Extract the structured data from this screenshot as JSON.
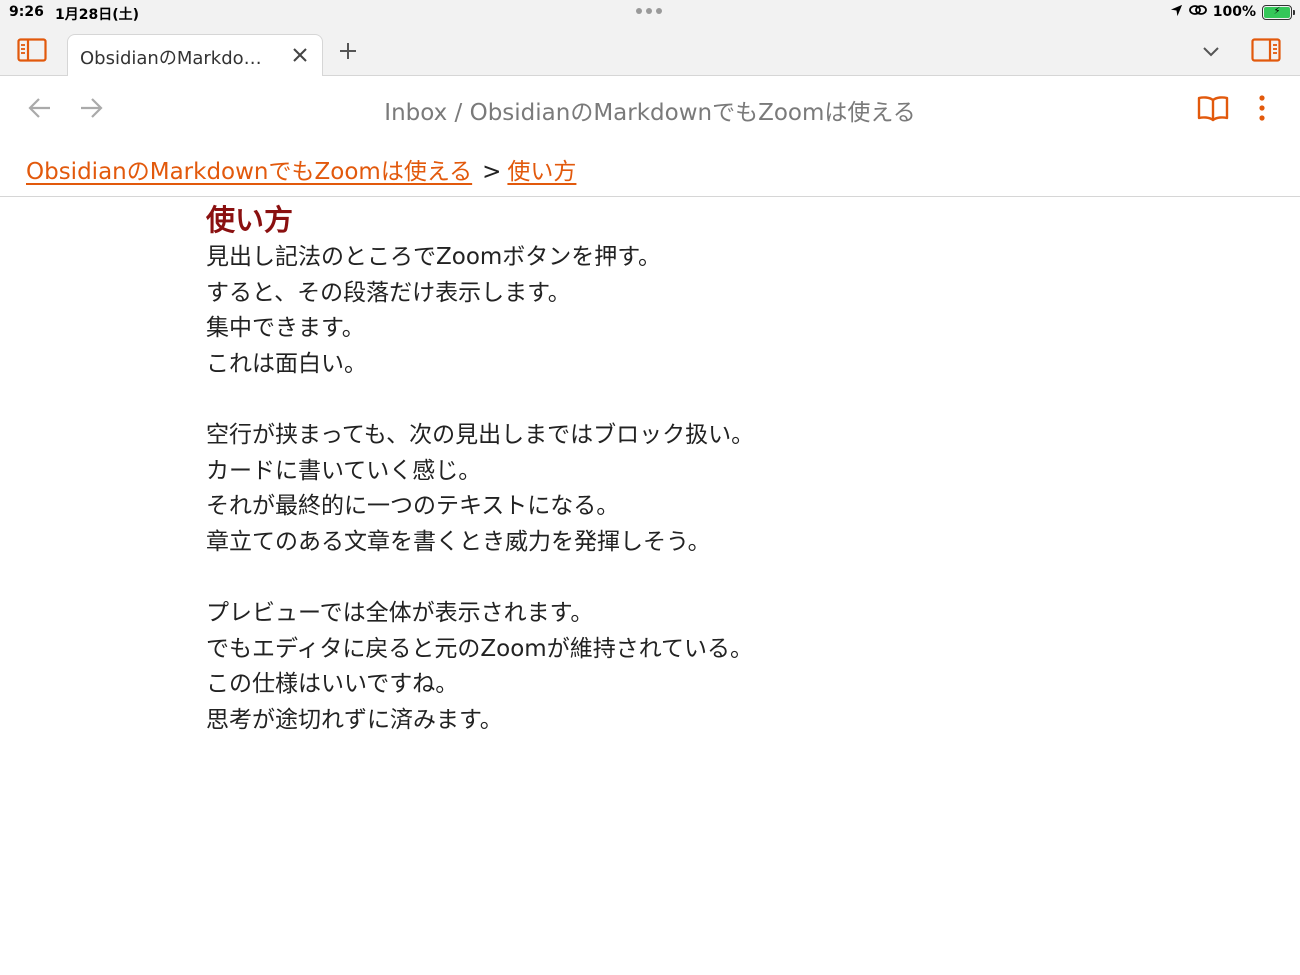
{
  "status_bar": {
    "time": "9:26",
    "date": "1月28日(土)",
    "battery": "100%",
    "icons": [
      "location-icon",
      "link-icon",
      "battery-icon"
    ]
  },
  "tab_bar": {
    "tabs": [
      {
        "label": "ObsidianのMarkdo…"
      }
    ],
    "icons": [
      "left-sidebar-icon",
      "close-icon",
      "plus-icon",
      "chevron-down-icon",
      "right-sidebar-icon"
    ]
  },
  "header": {
    "title": "Inbox / ObsidianのMarkdownでもZoomは使える",
    "icons": [
      "arrow-left-icon",
      "arrow-right-icon",
      "book-icon",
      "more-vertical-icon"
    ]
  },
  "breadcrumb": {
    "items": [
      {
        "label": "ObsidianのMarkdownでもZoomは使える"
      },
      {
        "label": "使い方"
      }
    ],
    "separator": ">"
  },
  "document": {
    "heading": "使い方",
    "lines": [
      "見出し記法のところでZoomボタンを押す。",
      "すると、その段落だけ表示します。",
      "集中できます。",
      "これは面白い。",
      "",
      "空行が挟まっても、次の見出しまではブロック扱い。",
      "カードに書いていく感じ。",
      "それが最終的に一つのテキストになる。",
      "章立てのある文章を書くとき威力を発揮しそう。",
      "",
      "プレビューでは全体が表示されます。",
      "でもエディタに戻ると元のZoomが維持されている。",
      "この仕様はいいですね。",
      "思考が途切れずに済みます。"
    ]
  },
  "colors": {
    "accent": "#e2590c",
    "heading": "#8a1010",
    "battery_green": "#34c759"
  }
}
